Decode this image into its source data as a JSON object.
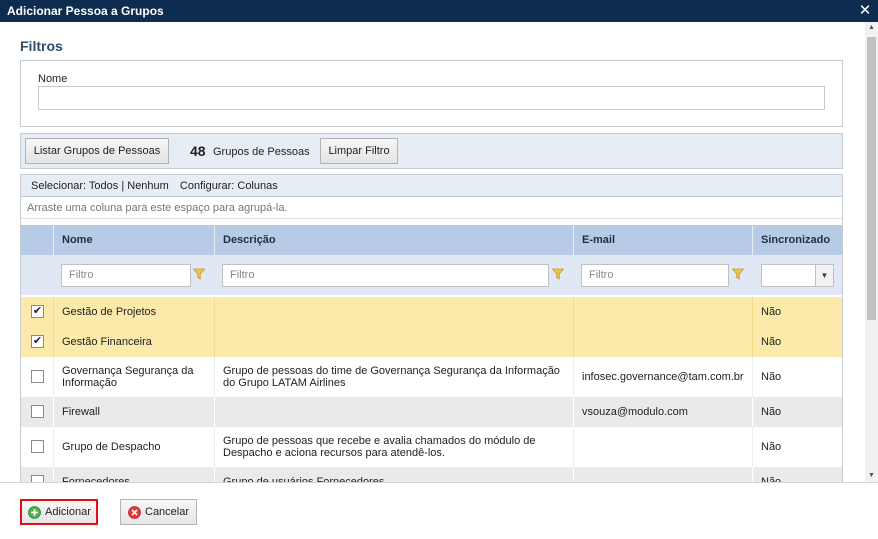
{
  "dialog": {
    "title": "Adicionar Pessoa a Grupos",
    "close": "✕"
  },
  "filters": {
    "title": "Filtros",
    "name_label": "Nome",
    "name_value": ""
  },
  "toolbar": {
    "list_button": "Listar Grupos de Pessoas",
    "count": "48",
    "count_label": "Grupos de Pessoas",
    "clear_button": "Limpar Filtro"
  },
  "grid": {
    "select_label": "Selecionar:",
    "select_all": "Todos",
    "select_sep": "|",
    "select_none": "Nenhum",
    "config_label": "Configurar:",
    "config_columns": "Colunas",
    "group_hint": "Arraste uma coluna para este espaço para agrupá-la.",
    "columns": [
      "Nome",
      "Descrição",
      "E-mail",
      "Sincronizado"
    ],
    "filter_placeholder": "Filtro",
    "rows": [
      {
        "checked": true,
        "name": "Gestão de Projetos",
        "description": "",
        "email": "",
        "sync": "Não"
      },
      {
        "checked": true,
        "name": "Gestão Financeira",
        "description": "",
        "email": "",
        "sync": "Não"
      },
      {
        "checked": false,
        "name": "Governança Segurança da Informação",
        "description": "Grupo de pessoas do time de Governança Segurança da Informação do Grupo LATAM Airlines",
        "email": "infosec.governance@tam.com.br",
        "sync": "Não"
      },
      {
        "checked": false,
        "name": "Firewall",
        "description": "",
        "email": "vsouza@modulo.com",
        "sync": "Não"
      },
      {
        "checked": false,
        "name": "Grupo de Despacho",
        "description": "Grupo de pessoas que recebe e avalia chamados do módulo de Despacho e aciona recursos para atendê-los.",
        "email": "",
        "sync": "Não"
      },
      {
        "checked": false,
        "name": "Fornecedores",
        "description": "Grupo de usuários Fornecedores.",
        "email": "",
        "sync": "Não"
      }
    ]
  },
  "footer": {
    "add_button": "Adicionar",
    "cancel_button": "Cancelar"
  },
  "colors": {
    "titlebar": "#0d2c4f",
    "header": "#b7cbe6",
    "selected_row": "#fbeaa9",
    "highlight_border": "#e0101a"
  }
}
